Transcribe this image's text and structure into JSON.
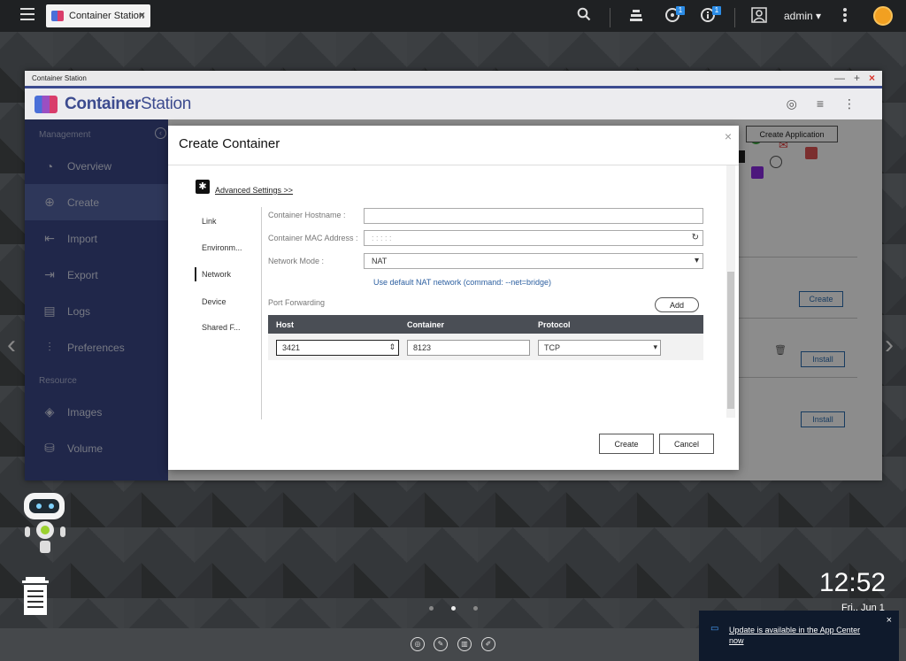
{
  "topbar": {
    "app_tab_label": "Container Station",
    "app_tab_close": "×",
    "user": "admin ▾",
    "badge_backup": "1",
    "badge_info": "1"
  },
  "window": {
    "title": "Container Station",
    "brand_bold": "Container",
    "brand_rest": "Station"
  },
  "sidebar": {
    "section_management": "Management",
    "section_resource": "Resource",
    "items": [
      {
        "label": "Overview"
      },
      {
        "label": "Create"
      },
      {
        "label": "Import"
      },
      {
        "label": "Export"
      },
      {
        "label": "Logs"
      },
      {
        "label": "Preferences"
      }
    ],
    "resource_items": [
      {
        "label": "Images"
      },
      {
        "label": "Volume"
      }
    ]
  },
  "content": {
    "create_application": "Create Application",
    "create_label": "Create",
    "install_label_1": "Install",
    "install_label_2": "Install"
  },
  "dialog": {
    "title": "Create Container",
    "close": "×",
    "advanced_settings": "Advanced Settings >>",
    "tabs": [
      "Link",
      "Environm...",
      "Network",
      "Device",
      "Shared F..."
    ],
    "fields": {
      "hostname_label": "Container Hostname :",
      "hostname_value": "",
      "mac_label": "Container MAC Address :",
      "mac_placeholder": ":  :  :  :  :",
      "network_mode_label": "Network Mode :",
      "network_mode_value": "NAT"
    },
    "hint": "Use default NAT network (command: --net=bridge)",
    "port_forwarding": {
      "label": "Port Forwarding",
      "add": "Add",
      "headers": [
        "Host",
        "Container",
        "Protocol"
      ],
      "rows": [
        {
          "host": "3421",
          "container": "8123",
          "protocol": "TCP"
        }
      ]
    },
    "create_button": "Create",
    "cancel_button": "Cancel"
  },
  "desktop": {
    "time": "12:52",
    "date": "Fri., Jun 1",
    "toast_message": "Update is available in the App Center now",
    "toast_close": "×"
  },
  "colors": {
    "accent": "#3c4b8f",
    "sidebar_active": "#5565a5",
    "link_blue": "#2c5fa0",
    "notification_bg": "#0f1a2c"
  }
}
